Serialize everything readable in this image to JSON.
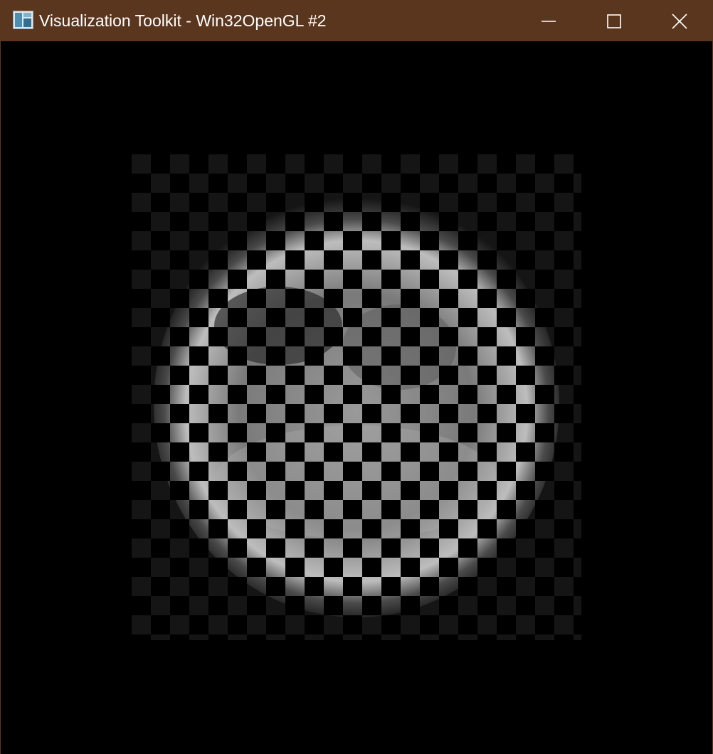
{
  "window": {
    "title": "Visualization Toolkit - Win32OpenGL #2",
    "app_icon": "vtk-app-icon",
    "controls": {
      "minimize": "minimize-icon",
      "maximize": "maximize-icon",
      "close": "close-icon"
    },
    "titlebar_color": "#5b361e"
  },
  "viewport": {
    "content": "checkerboard-image",
    "background": "#000000"
  }
}
